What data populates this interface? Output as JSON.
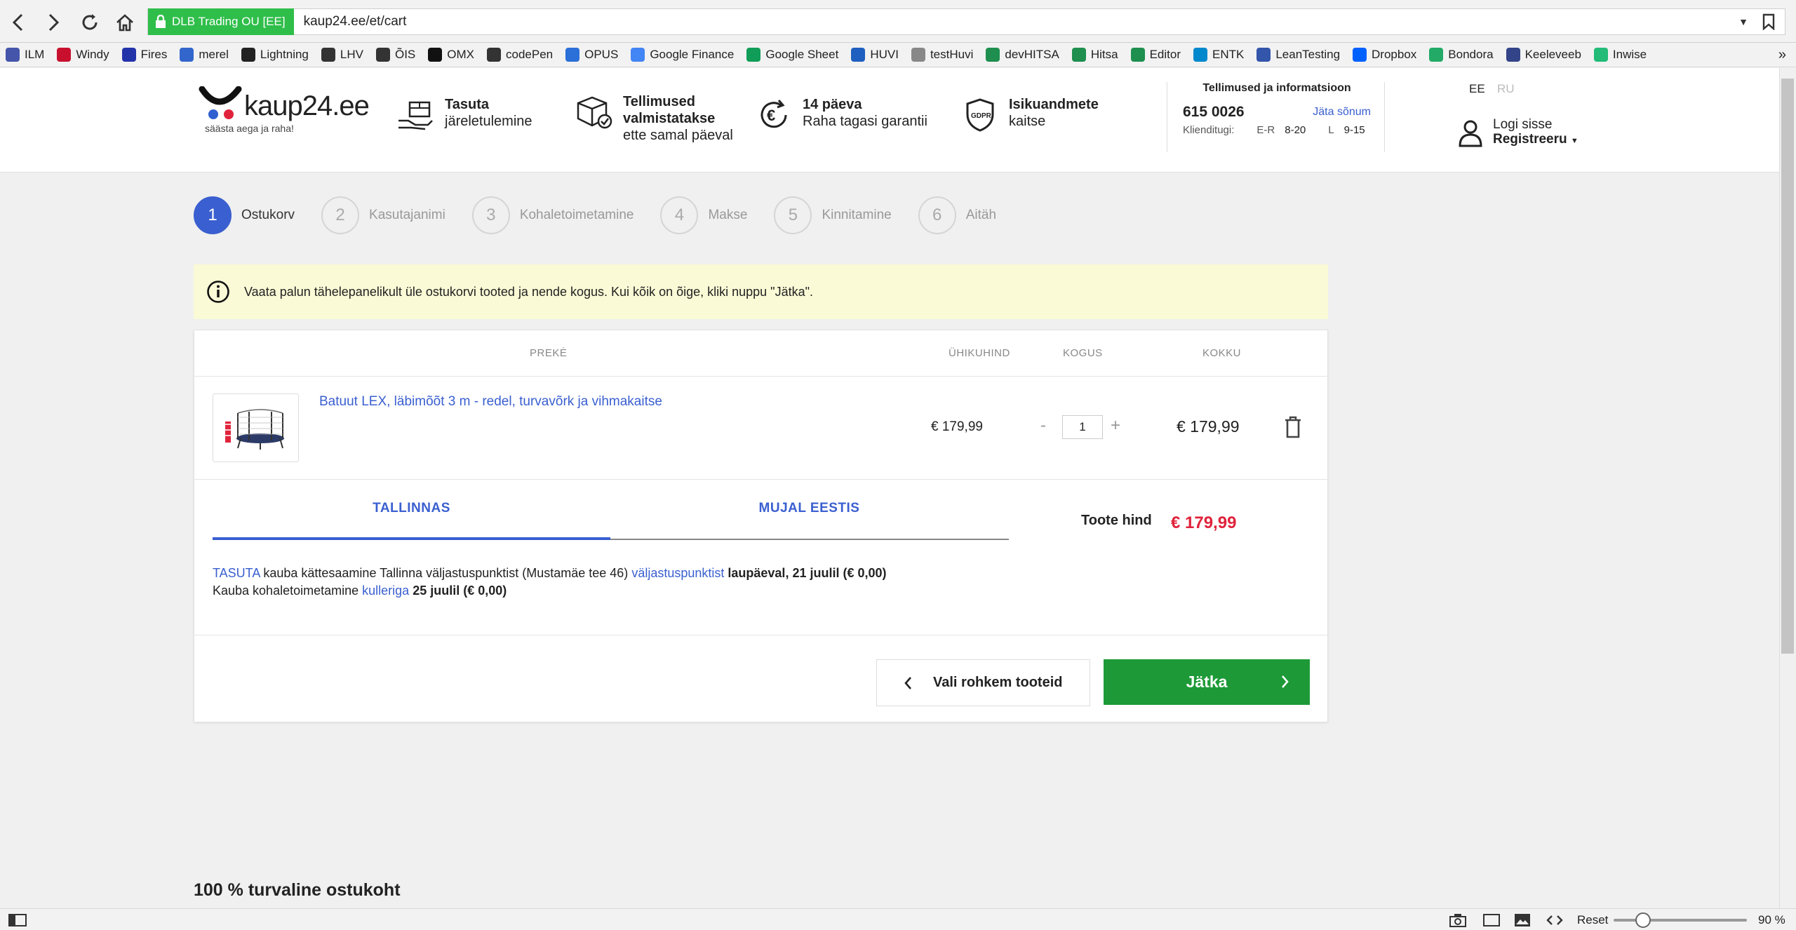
{
  "browser": {
    "security_label": "DLB Trading OU [EE]",
    "url": "kaup24.ee/et/cart",
    "bookmarks": [
      {
        "label": "ILM",
        "color": "#4455aa"
      },
      {
        "label": "Windy",
        "color": "#c8102e"
      },
      {
        "label": "Fires",
        "color": "#2233aa"
      },
      {
        "label": "merel",
        "color": "#3366cc"
      },
      {
        "label": "Lightning",
        "color": "#222222"
      },
      {
        "label": "LHV",
        "color": "#333333"
      },
      {
        "label": "ÕIS",
        "color": "#333333"
      },
      {
        "label": "OMX",
        "color": "#111111"
      },
      {
        "label": "codePen",
        "color": "#333333"
      },
      {
        "label": "OPUS",
        "color": "#2b6fd8"
      },
      {
        "label": "Google Finance",
        "color": "#4285f4"
      },
      {
        "label": "Google Sheet",
        "color": "#0f9d58"
      },
      {
        "label": "HUVI",
        "color": "#1f5fbf"
      },
      {
        "label": "testHuvi",
        "color": "#888888"
      },
      {
        "label": "devHITSA",
        "color": "#1e8f4e"
      },
      {
        "label": "Hitsa",
        "color": "#1e8f4e"
      },
      {
        "label": "Editor",
        "color": "#1e8f4e"
      },
      {
        "label": "ENTK",
        "color": "#0088cc"
      },
      {
        "label": "LeanTesting",
        "color": "#3355aa"
      },
      {
        "label": "Dropbox",
        "color": "#0061fe"
      },
      {
        "label": "Bondora",
        "color": "#22aa66"
      },
      {
        "label": "Keeleveeb",
        "color": "#334488"
      },
      {
        "label": "Inwise",
        "color": "#22bb77"
      }
    ],
    "bookmarks_more": "»",
    "zoom_reset": "Reset",
    "zoom_value": "90 %",
    "zoom_percent": 90
  },
  "header": {
    "logo_text": "kaup24.ee",
    "logo_tagline": "säästa aega ja raha!",
    "features": [
      {
        "icon": "return-box-icon",
        "bold": "Tasuta",
        "text": "järeletulemine"
      },
      {
        "icon": "package-check-icon",
        "bold": "Tellimused valmistatakse",
        "text": "ette samal päeval"
      },
      {
        "icon": "euro-refund-icon",
        "bold": "14 päeva",
        "text": "Raha tagasi garantii"
      },
      {
        "icon": "gdpr-shield-icon",
        "bold": "Isikuandmete",
        "text": "kaitse"
      }
    ],
    "info_title": "Tellimused ja informatsioon",
    "phone": "615 0026",
    "leave_message": "Jäta sõnum",
    "hours_label": "Klienditugi:",
    "hours_weekday_label": "E-R",
    "hours_weekday": "8-20",
    "hours_sat_label": "L",
    "hours_sat": "9-15",
    "lang_ee": "EE",
    "lang_ru": "RU",
    "login": "Logi sisse",
    "register": "Registreeru"
  },
  "steps": [
    {
      "n": "1",
      "label": "Ostukorv"
    },
    {
      "n": "2",
      "label": "Kasutajanimi"
    },
    {
      "n": "3",
      "label": "Kohaletoimetamine"
    },
    {
      "n": "4",
      "label": "Makse"
    },
    {
      "n": "5",
      "label": "Kinnitamine"
    },
    {
      "n": "6",
      "label": "Aitäh"
    }
  ],
  "notice": "Vaata palun tähelepanelikult üle ostukorvi tooted ja nende kogus. Kui kõik on õige, kliki nuppu \"Jätka\".",
  "cart": {
    "col_product": "PREKĖ",
    "col_unit": "ÜHIKUHIND",
    "col_qty": "KOGUS",
    "col_total": "KOKKU",
    "item": {
      "name": "Batuut LEX, läbimõõt 3 m - redel, turvavõrk ja vihmakaitse",
      "unit_price": "€ 179,99",
      "qty": "1",
      "minus": "-",
      "plus": "+",
      "total": "€ 179,99"
    },
    "tabs": [
      "TALLINNAS",
      "MUJAL EESTIS"
    ],
    "sum_label": "Toote hind",
    "sum_value": "€ 179,99",
    "delivery": {
      "l1_link1": "TASUTA",
      "l1_text1": " kauba kättesaamine Tallinna väljastuspunktist (Mustamäe tee 46) ",
      "l1_link2": "väljastuspunktist",
      "l1_bold": " laupäeval, 21 juulil (€ 0,00)",
      "l2_text": "Kauba kohaletoimetamine ",
      "l2_link": "kulleriga",
      "l2_bold": " 25 juulil (€ 0,00)"
    },
    "btn_back": "Vali rohkem tooteid",
    "btn_next": "Jätka"
  },
  "footer_title": "100 % turvaline ostukoht",
  "colors": {
    "accent": "#3a5fd0",
    "price_red": "#e0233b",
    "button_green": "#1d9a37",
    "notice_bg": "#fafad6"
  }
}
